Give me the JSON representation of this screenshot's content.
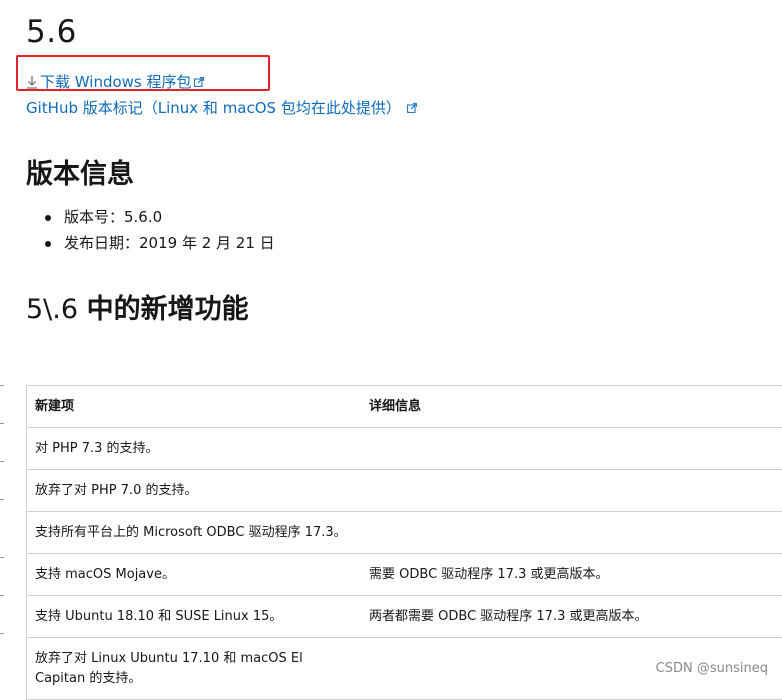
{
  "version_heading": "5.6",
  "links": {
    "download": "下载 Windows 程序包",
    "github": "GitHub 版本标记（Linux 和 macOS 包均在此处提供）"
  },
  "release_info": {
    "heading": "版本信息",
    "items": [
      "版本号：5.6.0",
      "发布日期：2019 年 2 月 21 日"
    ]
  },
  "whats_new": {
    "heading_prefix": "5\\.6 ",
    "heading_bold": "中的新增功能"
  },
  "table": {
    "headers": [
      "新建项",
      "详细信息"
    ],
    "rows": [
      [
        "对 PHP 7.3 的支持。",
        ""
      ],
      [
        "放弃了对 PHP 7.0 的支持。",
        ""
      ],
      [
        "支持所有平台上的 Microsoft ODBC 驱动程序 17.3。",
        ""
      ],
      [
        "支持 macOS Mojave。",
        "需要 ODBC 驱动程序 17.3 或更高版本。"
      ],
      [
        "支持 Ubuntu 18.10 和 SUSE Linux 15。",
        "两者都需要 ODBC 驱动程序 17.3 或更高版本。"
      ],
      [
        "放弃了对 Linux Ubuntu 17.10 和 macOS El Capitan 的支持。",
        ""
      ]
    ]
  },
  "watermark": "CSDN @sunsineq",
  "colors": {
    "link": "#0f6cbd",
    "highlight_box": "#e0242b"
  },
  "icons": {
    "download": "download-icon",
    "external": "external-link-icon"
  }
}
